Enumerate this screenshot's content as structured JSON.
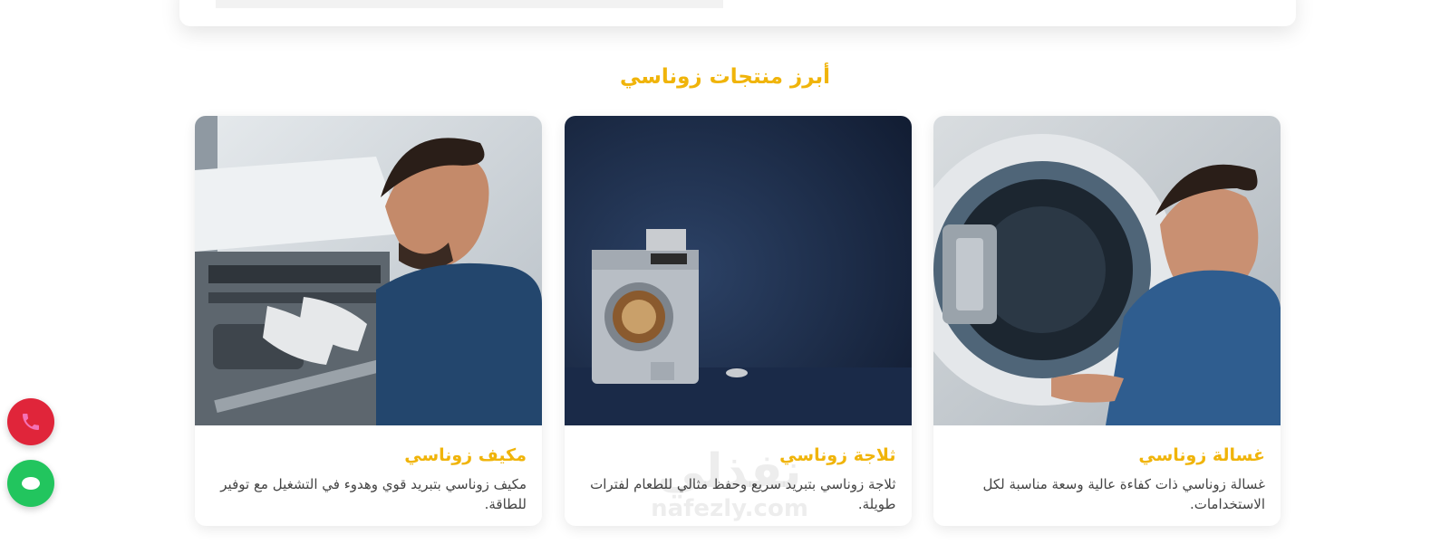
{
  "section": {
    "title": "أبرز منتجات زوناسي"
  },
  "products": [
    {
      "title": "غسالة زوناسي",
      "description": "غسالة زوناسي ذات كفاءة عالية وسعة مناسبة لكل الاستخدامات.",
      "image_icon": "washing-machine-technician-photo"
    },
    {
      "title": "ثلاجة زوناسي",
      "description": "ثلاجة زوناسي بتبريد سريع وحفظ مثالي للطعام لفترات طويلة.",
      "image_icon": "appliance-photo"
    },
    {
      "title": "مكيف زوناسي",
      "description": "مكيف زوناسي بتبريد قوي وهدوء في التشغيل مع توفير للطاقة.",
      "image_icon": "ac-technician-photo"
    }
  ],
  "floating": {
    "call_icon": "phone-icon",
    "whatsapp_icon": "whatsapp-icon"
  },
  "watermark": {
    "brand": "نفذلي",
    "site": "nafezly.com"
  },
  "colors": {
    "accent": "#f0b40a",
    "call": "#e0253a",
    "whatsapp": "#22c55e"
  }
}
